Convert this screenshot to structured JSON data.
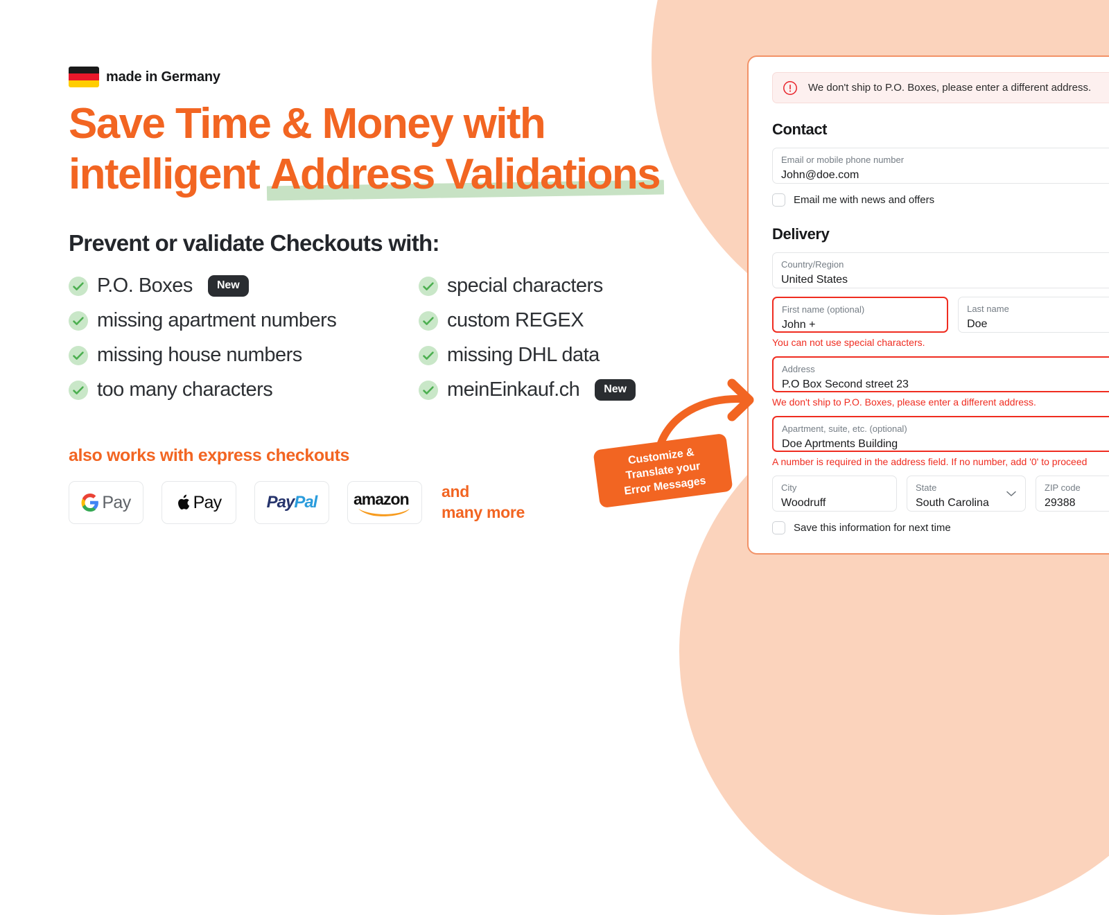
{
  "brand": {
    "accent_orange": "#f26522",
    "dark": "#17181a",
    "check_green": "#4caf50",
    "check_green_bg": "#c9e7c8",
    "highlight_green": "#c7e2c4",
    "error_red": "#ef2c20",
    "blob_peach": "#fbd3bc"
  },
  "marketing": {
    "made_in_label": "made in Germany",
    "flag_icon": "german-flag-icon",
    "headline_line1": "Save Time & Money with",
    "headline_line2_prefix": "intelligent ",
    "headline_line2_highlight": "Address Validations",
    "subhead": "Prevent or validate Checkouts with:",
    "features_left": [
      {
        "label": "P.O. Boxes",
        "badge": "New"
      },
      {
        "label": "missing apartment numbers",
        "badge": ""
      },
      {
        "label": "missing house numbers",
        "badge": ""
      },
      {
        "label": "too many characters",
        "badge": ""
      }
    ],
    "features_right": [
      {
        "label": "special characters",
        "badge": ""
      },
      {
        "label": "custom REGEX",
        "badge": ""
      },
      {
        "label": "missing DHL data",
        "badge": ""
      },
      {
        "label": "meinEinkauf.ch",
        "badge": "New"
      }
    ],
    "express_title": "also works with express checkouts",
    "payments": [
      {
        "name": "google-pay-logo",
        "text": "Pay"
      },
      {
        "name": "apple-pay-logo",
        "text": "Pay"
      },
      {
        "name": "paypal-logo",
        "text_1": "Pay",
        "text_2": "Pal"
      },
      {
        "name": "amazon-pay-logo",
        "text": "amazon"
      }
    ],
    "and_many_more_line1": "and",
    "and_many_more_line2": "many more"
  },
  "sticker": {
    "line1": "Customize &",
    "line2": "Translate your",
    "line3": "Error Messages",
    "arrow_icon": "curved-arrow-right-icon"
  },
  "checkout": {
    "alert": {
      "icon": "error-circle-icon",
      "text": "We don't ship to P.O. Boxes, please enter a different address."
    },
    "contact": {
      "title": "Contact",
      "email": {
        "label": "Email or mobile phone number",
        "value": "John@doe.com"
      },
      "newsletter_checkbox_label": "Email me with news and offers"
    },
    "delivery": {
      "title": "Delivery",
      "country": {
        "label": "Country/Region",
        "value": "United States"
      },
      "first_name": {
        "label": "First name (optional)",
        "value": "John +",
        "error": "You can not use special characters."
      },
      "last_name": {
        "label": "Last name",
        "value": "Doe"
      },
      "address": {
        "label": "Address",
        "value": "P.O Box Second street 23",
        "error": "We don't ship to P.O. Boxes, please enter a different address."
      },
      "apartment": {
        "label": "Apartment, suite, etc. (optional)",
        "value": "Doe Aprtments Building",
        "error": "A number is required in the address field. If no number, add '0' to proceed"
      },
      "city": {
        "label": "City",
        "value": "Woodruff"
      },
      "state": {
        "label": "State",
        "value": "South Carolina",
        "icon": "chevron-down-icon"
      },
      "zip": {
        "label": "ZIP code",
        "value": "29388"
      },
      "save_checkbox_label": "Save this information for next time"
    }
  }
}
